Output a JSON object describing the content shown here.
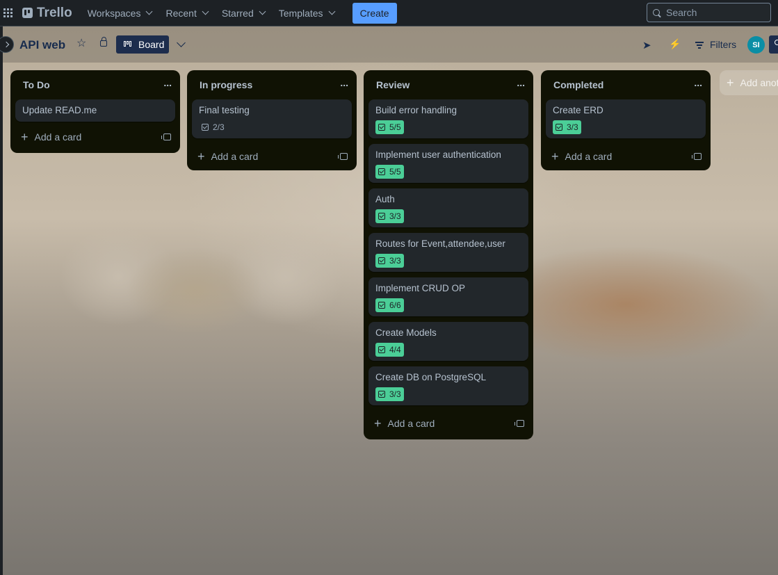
{
  "nav": {
    "logo_text": "Trello",
    "workspaces": "Workspaces",
    "recent": "Recent",
    "starred": "Starred",
    "templates": "Templates",
    "create": "Create",
    "search_placeholder": "Search"
  },
  "board": {
    "title": "API web",
    "view_label": "Board",
    "filters_label": "Filters",
    "avatar_initials": "SI",
    "add_list_label": "Add anot"
  },
  "lists": [
    {
      "title": "To Do",
      "cards": [
        {
          "title": "Update READ.me",
          "badge": ""
        }
      ],
      "add_label": "Add a card"
    },
    {
      "title": "In progress",
      "cards": [
        {
          "title": "Final testing",
          "badge": "2/3",
          "complete": false
        }
      ],
      "add_label": "Add a card"
    },
    {
      "title": "Review",
      "cards": [
        {
          "title": "Build error handling",
          "badge": "5/5",
          "complete": true
        },
        {
          "title": "Implement user authentication",
          "badge": "5/5",
          "complete": true
        },
        {
          "title": "Auth",
          "badge": "3/3",
          "complete": true
        },
        {
          "title": "Routes for Event,attendee,user",
          "badge": "3/3",
          "complete": true
        },
        {
          "title": "Implement CRUD OP",
          "badge": "6/6",
          "complete": true
        },
        {
          "title": "Create Models",
          "badge": "4/4",
          "complete": true
        },
        {
          "title": "Create DB on PostgreSQL",
          "badge": "3/3",
          "complete": true
        }
      ],
      "add_label": "Add a card"
    },
    {
      "title": "Completed",
      "cards": [
        {
          "title": "Create ERD",
          "badge": "3/3",
          "complete": true
        }
      ],
      "add_label": "Add a card"
    }
  ],
  "colors": {
    "nav_bg": "#1d2125",
    "list_bg": "#101204",
    "card_bg": "#22272b",
    "complete_badge": "#4bce97",
    "create_button": "#579dff",
    "board_button": "#1d2d4d",
    "avatar": "#0a8ea5"
  }
}
